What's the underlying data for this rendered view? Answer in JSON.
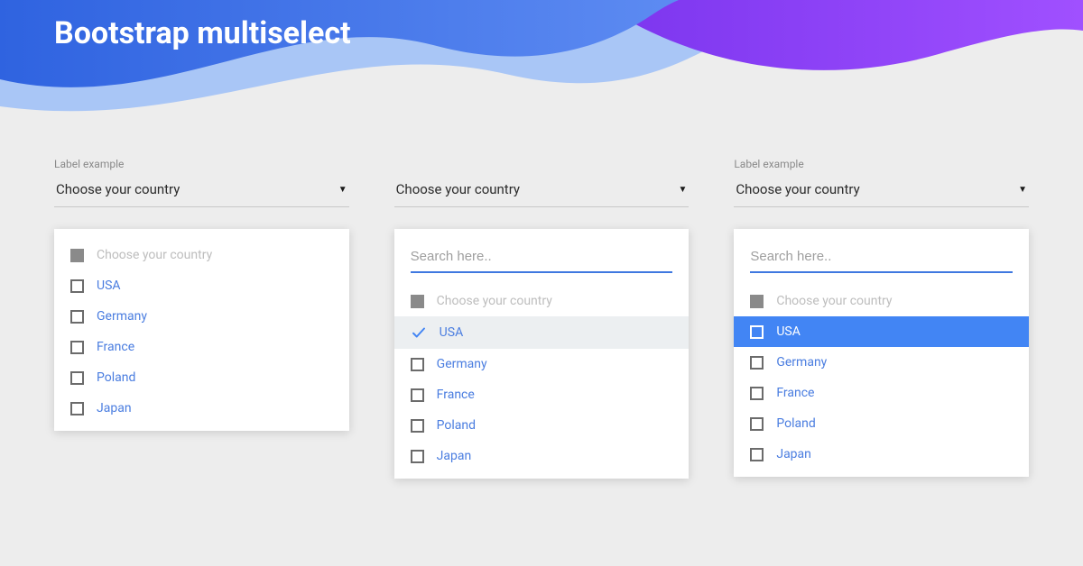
{
  "header": {
    "title": "Bootstrap multiselect"
  },
  "labels": {
    "field_label": "Label example",
    "select_placeholder": "Choose your country",
    "search_placeholder": "Search here..",
    "option_placeholder": "Choose your country"
  },
  "countries": [
    "USA",
    "Germany",
    "France",
    "Poland",
    "Japan"
  ],
  "colors": {
    "accent": "#4285f4",
    "link": "#4a7de0",
    "wave_blue": "#3a6ee8",
    "wave_blue_light": "#9fc0f3",
    "wave_purple": "#8a3af0"
  }
}
